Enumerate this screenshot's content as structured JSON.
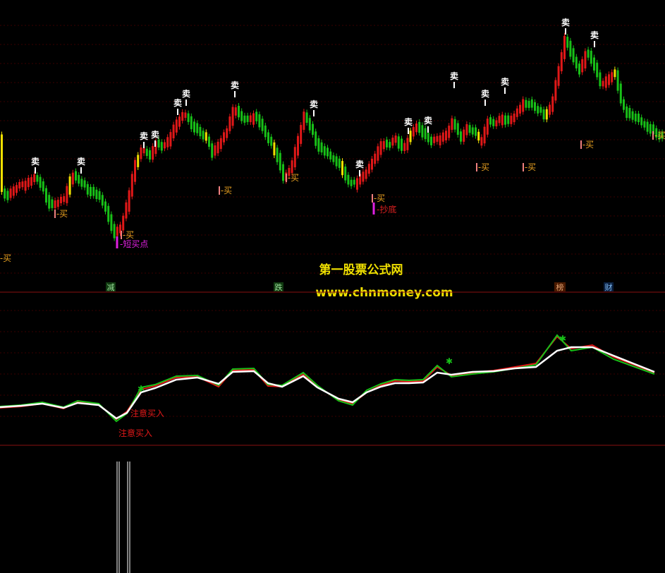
{
  "colors": {
    "background": "#000000",
    "grid": "#3a0000",
    "divider": "#8a1010",
    "up": "#e01818",
    "down": "#18c018",
    "signal_yellow": "#f0e000",
    "sell_text": "#ffffff",
    "buy_text": "#e8a020",
    "buy_marker": "#f08080",
    "magenta": "#e020e0",
    "watermark": "#f0e000",
    "line_white": "#ffffff",
    "line_red": "#e01818",
    "line_green": "#18c018",
    "histogram": "#ffffff"
  },
  "watermark": {
    "title": "第一股票公式网",
    "url": "www.chnmoney.com"
  },
  "chart_data": [
    {
      "type": "candlestick",
      "panel": "main",
      "x": [
        0,
        10,
        20,
        30,
        40,
        50,
        60,
        70,
        80,
        90,
        100,
        110,
        120,
        130,
        140,
        150,
        160,
        170,
        180,
        190,
        200,
        210,
        220,
        230,
        240,
        250,
        260,
        270,
        280,
        290,
        300,
        310,
        320,
        330,
        340,
        350,
        360,
        370,
        380,
        390,
        400,
        410,
        420,
        430,
        440,
        450,
        460,
        470,
        480,
        490,
        500,
        510,
        520,
        530,
        540,
        550,
        560,
        570,
        580,
        590,
        600,
        610,
        620,
        630,
        640,
        650,
        660,
        670,
        680,
        690,
        700,
        710,
        720,
        730,
        740,
        750,
        760,
        770,
        780,
        790,
        800,
        810,
        820,
        830,
        840,
        850,
        860,
        870,
        880,
        890,
        900,
        910,
        920,
        930,
        940
      ],
      "close": [
        270,
        275,
        265,
        260,
        255,
        250,
        270,
        290,
        285,
        280,
        245,
        255,
        265,
        270,
        280,
        300,
        330,
        320,
        280,
        230,
        210,
        220,
        200,
        210,
        190,
        170,
        160,
        175,
        185,
        195,
        215,
        200,
        185,
        150,
        165,
        170,
        160,
        180,
        200,
        215,
        250,
        240,
        200,
        160,
        185,
        205,
        215,
        225,
        230,
        255,
        260,
        250,
        240,
        220,
        200,
        205,
        195,
        210,
        190,
        175,
        190,
        200,
        195,
        190,
        170,
        195,
        180,
        185,
        200,
        170,
        175,
        165,
        170,
        160,
        145,
        145,
        155,
        160,
        150,
        100,
        50,
        80,
        100,
        70,
        90,
        120,
        110,
        100,
        150,
        160,
        165,
        175,
        180,
        190,
        195
      ],
      "sell_signals": [
        "卖",
        "卖",
        "卖",
        "卖",
        "卖",
        "卖",
        "卖",
        "卖",
        "卖",
        "卖",
        "卖",
        "卖",
        "卖",
        "卖",
        "卖",
        "卖",
        "卖",
        "卖"
      ],
      "buy_signals": [
        "买",
        "买",
        "买",
        "买",
        "买",
        "买",
        "买",
        "买",
        "买",
        "买"
      ],
      "labels": [
        "短买点",
        "抄底"
      ]
    },
    {
      "type": "line",
      "panel": "indicator",
      "series": [
        {
          "values": [
            575,
            575,
            570,
            570,
            575,
            570,
            565,
            568,
            570,
            575,
            580,
            585,
            590,
            600,
            560,
            555,
            550,
            545,
            540,
            545,
            540,
            535,
            530,
            535,
            545,
            550,
            545,
            535,
            530,
            535,
            540,
            535,
            530,
            530,
            535,
            530,
            530
          ]
        },
        {
          "values": [
            578,
            578,
            574,
            574,
            578,
            574,
            570,
            570,
            572,
            578,
            583,
            588,
            592,
            598,
            562,
            558,
            553,
            548,
            543,
            547,
            543,
            538,
            533,
            537,
            547,
            552,
            547,
            538,
            533,
            537,
            542,
            537,
            533,
            532,
            537,
            533,
            532
          ]
        },
        {
          "values": [
            580,
            580,
            576,
            576,
            580,
            576,
            572,
            572,
            574,
            580,
            585,
            590,
            594,
            596,
            564,
            560,
            555,
            550,
            545,
            549,
            545,
            540,
            535,
            539,
            549,
            554,
            549,
            540,
            535,
            539,
            544,
            539,
            535,
            534,
            539,
            535,
            534
          ]
        }
      ],
      "annotations": [
        "注意买入",
        "注意买入"
      ]
    },
    {
      "type": "bar",
      "panel": "histogram",
      "values": [
        1,
        1
      ]
    }
  ],
  "sector_tags": [
    "减",
    "跌",
    "榜",
    "财"
  ]
}
